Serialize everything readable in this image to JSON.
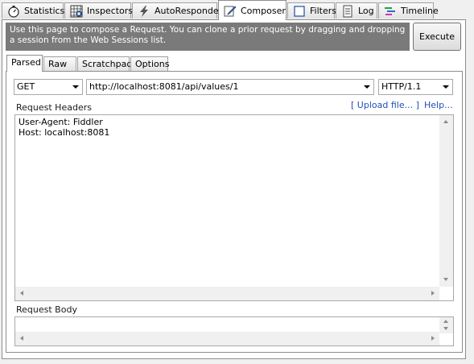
{
  "tabs": [
    {
      "label": "Statistics",
      "icon": "stopwatch-icon"
    },
    {
      "label": "Inspectors",
      "icon": "inspectors-grid-icon"
    },
    {
      "label": "AutoResponder",
      "icon": "lightning-icon"
    },
    {
      "label": "Composer",
      "icon": "pencil-icon",
      "active": true
    },
    {
      "label": "Filters",
      "icon": "checkbox-icon"
    },
    {
      "label": "Log",
      "icon": "document-icon"
    },
    {
      "label": "Timeline",
      "icon": "timeline-icon"
    }
  ],
  "composer": {
    "banner_text": "Use this page to compose a Request. You can clone a prior request by dragging and dropping a session from the Web Sessions list.",
    "execute_label": "Execute",
    "subtabs": [
      {
        "label": "Parsed",
        "active": true
      },
      {
        "label": "Raw"
      },
      {
        "label": "Scratchpad"
      },
      {
        "label": "Options"
      }
    ],
    "method": "GET",
    "url": "http://localhost:8081/api/values/1",
    "http_version": "HTTP/1.1",
    "request_headers_label": "Request Headers",
    "upload_file_link": "[ Upload file... ]",
    "help_link": "Help...",
    "request_headers_text": "User-Agent: Fiddler\nHost: localhost:8081",
    "request_body_label": "Request Body",
    "request_body_text": ""
  }
}
